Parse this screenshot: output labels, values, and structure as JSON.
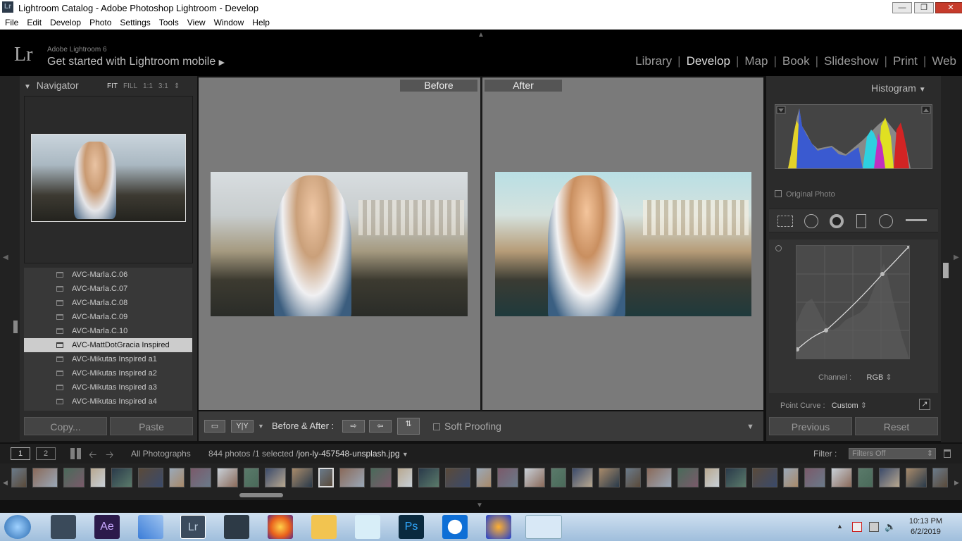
{
  "window": {
    "title": "Lightroom Catalog - Adobe Photoshop Lightroom - Develop",
    "app_icon": "Lr"
  },
  "menu": [
    "File",
    "Edit",
    "Develop",
    "Photo",
    "Settings",
    "Tools",
    "View",
    "Window",
    "Help"
  ],
  "identity": {
    "logo": "Lr",
    "product": "Adobe Lightroom 6",
    "cta": "Get started with Lightroom mobile"
  },
  "modules": [
    "Library",
    "Develop",
    "Map",
    "Book",
    "Slideshow",
    "Print",
    "Web"
  ],
  "active_module": "Develop",
  "navigator": {
    "title": "Navigator",
    "options": [
      "FIT",
      "FILL",
      "1:1",
      "3:1"
    ]
  },
  "presets": [
    "AVC-Marla.C.06",
    "AVC-Marla.C.07",
    "AVC-Marla.C.08",
    "AVC-Marla.C.09",
    "AVC-Marla.C.10",
    "AVC-MattDotGracia Inspired",
    "AVC-Mikutas Inspired a1",
    "AVC-Mikutas Inspired a2",
    "AVC-Mikutas Inspired a3",
    "AVC-Mikutas Inspired a4"
  ],
  "selected_preset": "AVC-MattDotGracia Inspired",
  "left_buttons": {
    "copy": "Copy...",
    "paste": "Paste"
  },
  "view": {
    "before": "Before",
    "after": "After"
  },
  "toolbar": {
    "yy": "Y|Y",
    "before_after_label": "Before & After :",
    "soft_proofing": "Soft Proofing"
  },
  "histogram": {
    "title": "Histogram",
    "original_photo": "Original Photo"
  },
  "tone_curve": {
    "channel_label": "Channel :",
    "channel_value": "RGB",
    "point_curve_label": "Point Curve :",
    "point_curve_value": "Custom"
  },
  "right_buttons": {
    "previous": "Previous",
    "reset": "Reset"
  },
  "filmstrip_bar": {
    "screen1": "1",
    "screen2": "2",
    "source": "All Photographs",
    "count": "844 photos /1 selected /",
    "filename": "jon-ly-457548-unsplash.jpg",
    "filter_label": "Filter :",
    "filter_value": "Filters Off"
  },
  "clock": {
    "time": "10:13 PM",
    "date": "6/2/2019"
  }
}
